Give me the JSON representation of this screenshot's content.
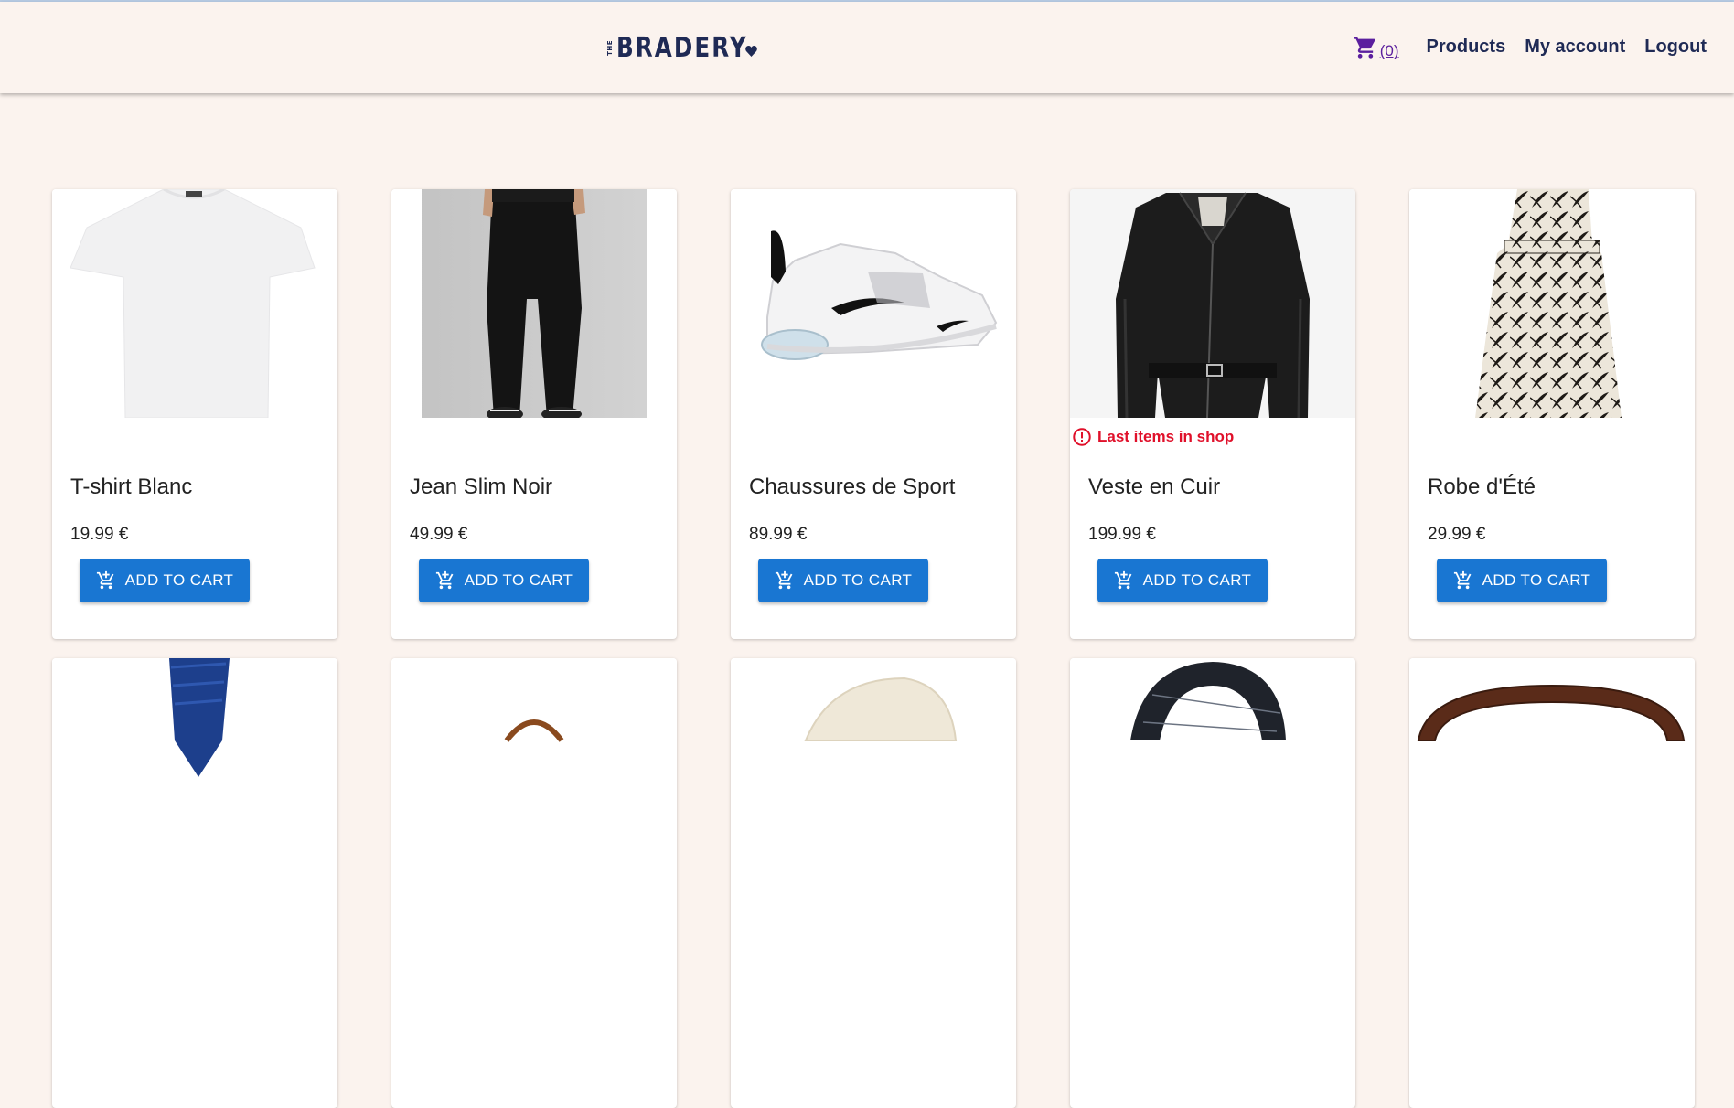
{
  "brand": {
    "name": "BRADERY",
    "prefix": "THE",
    "color": "#1f2a55"
  },
  "nav": {
    "cart_icon": "shopping-cart-icon",
    "cart_count": "(0)",
    "products": "Products",
    "account": "My account",
    "logout": "Logout"
  },
  "colors": {
    "background": "#fbf3ee",
    "button": "#1976d2",
    "warning": "#e0102a",
    "link_purple": "#5b1f9e"
  },
  "products": [
    {
      "name": "T-shirt Blanc",
      "price": "19.99 €",
      "button": "ADD TO CART",
      "warning": ""
    },
    {
      "name": "Jean Slim Noir",
      "price": "49.99 €",
      "button": "ADD TO CART",
      "warning": ""
    },
    {
      "name": "Chaussures de Sport",
      "price": "89.99 €",
      "button": "ADD TO CART",
      "warning": ""
    },
    {
      "name": "Veste en Cuir",
      "price": "199.99 €",
      "button": "ADD TO CART",
      "warning": "Last items in shop"
    },
    {
      "name": "Robe d'Été",
      "price": "29.99 €",
      "button": "ADD TO CART",
      "warning": ""
    }
  ]
}
